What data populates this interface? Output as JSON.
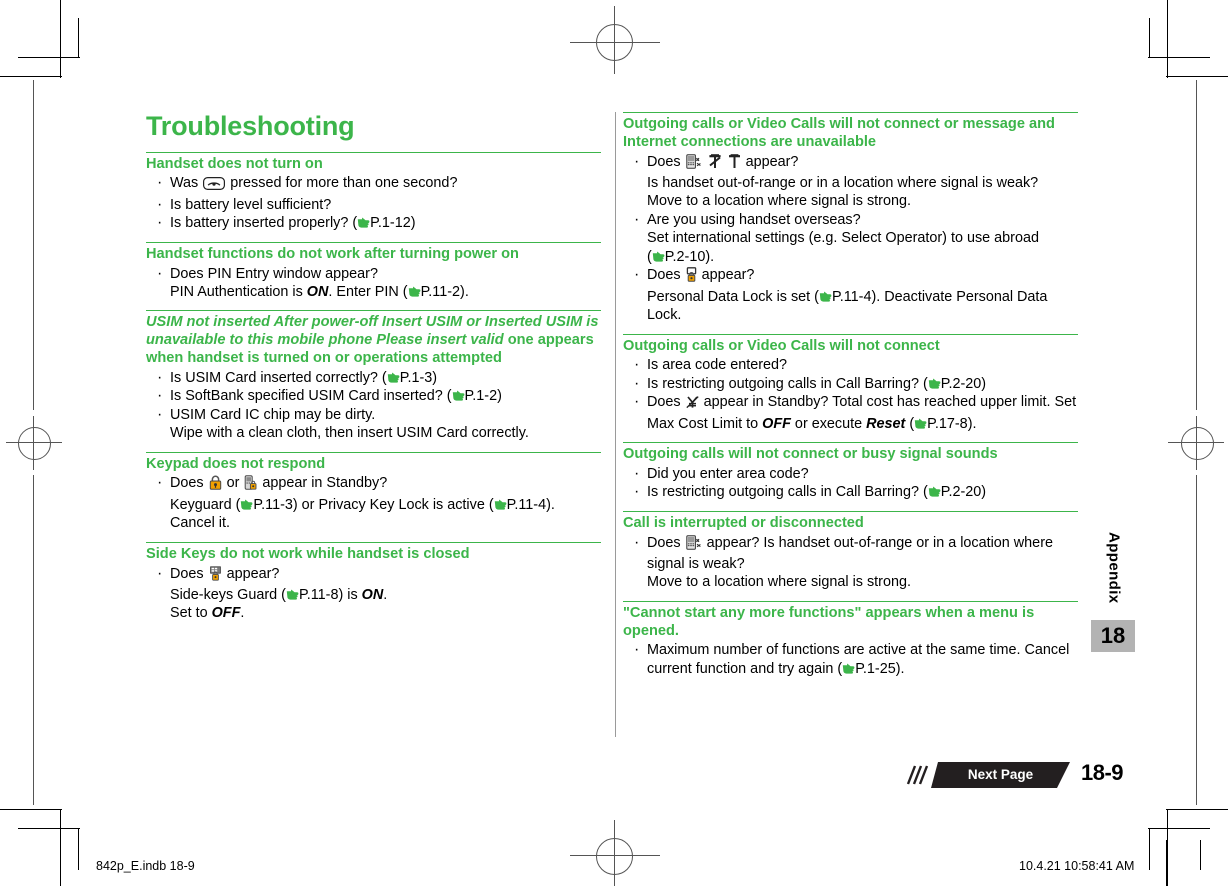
{
  "document": {
    "title": "Troubleshooting",
    "chapter_label": "Appendix",
    "chapter_number": "18",
    "page_number": "18-9",
    "next_page_label": "Next Page"
  },
  "print_marks": {
    "file_name": "842p_E.indb   18-9",
    "timestamp": "10.4.21   10:58:41 AM"
  },
  "left_column": {
    "sections": [
      {
        "heading": "Handset does not turn on",
        "items": [
          {
            "lead": "Was ",
            "icon": "power-key-icon",
            "tail": " pressed for more than one second?",
            "sub": []
          },
          {
            "lead": "Is battery level sufficient?",
            "sub": []
          },
          {
            "lead": "Is battery inserted properly? (",
            "ref": "P.1-12",
            "tail": ")",
            "sub": []
          }
        ]
      },
      {
        "heading": "Handset functions do not work after turning power on",
        "items": [
          {
            "lead": "Does PIN Entry window appear?",
            "sub": [
              "PIN Authentication is ON. Enter PIN (P.11-2)."
            ]
          }
        ]
      },
      {
        "heading_italic": "USIM not inserted After power-off Insert USIM or Inserted USIM is unavailable to this mobile phone Please insert valid",
        "heading_rest": " one appears when handset is turned on or operations attempted",
        "items": [
          {
            "lead": "Is USIM Card inserted correctly? (",
            "ref": "P.1-3",
            "tail": ")",
            "sub": []
          },
          {
            "lead": "Is SoftBank specified USIM Card inserted? (",
            "ref": "P.1-2",
            "tail": ")",
            "sub": []
          },
          {
            "lead": "USIM Card IC chip may be dirty.",
            "sub": [
              "Wipe with a clean cloth, then insert USIM Card correctly."
            ]
          }
        ]
      },
      {
        "heading": "Keypad does not respond",
        "items": [
          {
            "lead": "Does ",
            "icon": "padlock-icon",
            "mid": " or ",
            "icon2": "phone-lock-icon",
            "tail": " appear in Standby?",
            "sub": [
              "Keyguard (P.11-3) or Privacy Key Lock is active (P.11-4). Cancel it."
            ]
          }
        ]
      },
      {
        "heading": "Side Keys do not work while handset is closed",
        "items": [
          {
            "lead": "Does ",
            "icon": "side-keys-guard-icon",
            "tail": " appear?",
            "sub": [
              "Side-keys Guard (P.11-8) is ON.",
              "Set to OFF."
            ]
          }
        ]
      }
    ]
  },
  "right_column": {
    "sections": [
      {
        "heading": "Outgoing calls or Video Calls will not connect or message and Internet connections are unavailable",
        "items": [
          {
            "lead": "Does ",
            "icons": [
              "out-of-range-icon",
              "no-signal-icon",
              "antenna-icon"
            ],
            "tail": " appear?",
            "sub": [
              "Is handset out-of-range or in a location where signal is weak?",
              "Move to a location where signal is strong."
            ]
          },
          {
            "lead": "Are you using handset overseas?",
            "sub": [
              "Set international settings (e.g. Select Operator) to use abroad (P.2-10)."
            ]
          },
          {
            "lead": "Does ",
            "icon": "personal-data-lock-icon",
            "tail": " appear?",
            "sub": [
              "Personal Data Lock is set (P.11-4). Deactivate Personal Data Lock."
            ]
          }
        ]
      },
      {
        "heading": "Outgoing calls or Video Calls will not connect",
        "items": [
          {
            "lead": "Is area code entered?",
            "sub": []
          },
          {
            "lead": "Is restricting outgoing calls in Call Barring? (",
            "ref": "P.2-20",
            "tail": ")",
            "sub": []
          },
          {
            "lead": "Does ",
            "icon": "max-cost-limit-icon",
            "tail": " appear in Standby? Total cost has reached upper limit. Set Max Cost Limit to OFF or execute Reset (P.17-8).",
            "sub": []
          }
        ]
      },
      {
        "heading": "Outgoing calls will not connect or busy signal sounds",
        "items": [
          {
            "lead": "Did you enter area code?",
            "sub": []
          },
          {
            "lead": "Is restricting outgoing calls in Call Barring? (",
            "ref": "P.2-20",
            "tail": ")",
            "sub": []
          }
        ]
      },
      {
        "heading": "Call is interrupted or disconnected",
        "items": [
          {
            "lead": "Does ",
            "icon": "out-of-range-icon",
            "tail": " appear? Is handset out-of-range or in a location where signal is weak?",
            "sub": [
              "Move to a location where signal is strong."
            ]
          }
        ]
      },
      {
        "heading": "\"Cannot start any more functions\" appears when a menu is opened.",
        "items": [
          {
            "lead": "Maximum number of functions are active at the same time. Cancel current function and try again (",
            "ref": "P.1-25",
            "tail": ").",
            "sub": []
          }
        ]
      }
    ]
  },
  "refs": {
    "p1_12": "P.1-12",
    "p11_2": "P.11-2",
    "p1_3": "P.1-3",
    "p1_2": "P.1-2",
    "p11_3": "P.11-3",
    "p11_4": "P.11-4",
    "p11_8": "P.11-8",
    "p2_10": "P.2-10",
    "p2_20": "P.2-20",
    "p17_8": "P.17-8",
    "p1_25": "P.1-25"
  },
  "colors": {
    "accent_green": "#3cb54a",
    "tab_gray": "#b3b3b3",
    "bar_black": "#231f20"
  }
}
